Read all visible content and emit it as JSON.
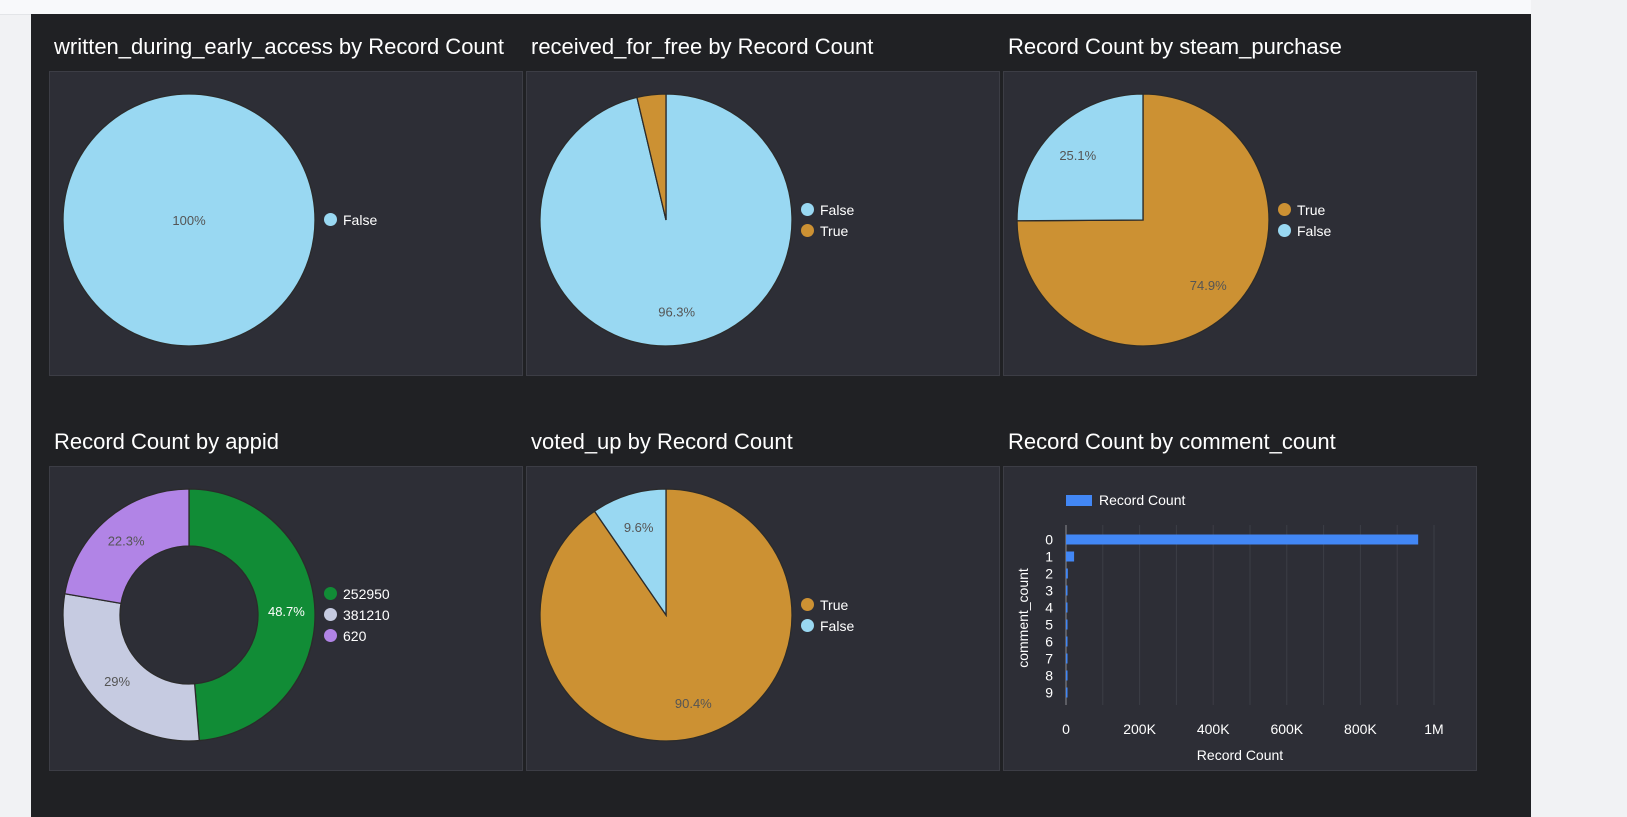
{
  "colors": {
    "gold": "#cc9133",
    "sky": "#99d8f2",
    "green": "#118c36",
    "lavender": "#c6cbe1",
    "purple": "#b184e6",
    "blue": "#4287f5",
    "panel_bg": "#2d2e36",
    "page_bg": "#202124"
  },
  "chart_data": [
    {
      "type": "pie",
      "title": "written_during_early_access by Record Count",
      "slices": [
        {
          "label": "False",
          "value": 100,
          "display": "100%",
          "color": "#99d8f2"
        }
      ],
      "legend": [
        "False"
      ]
    },
    {
      "type": "pie",
      "title": "received_for_free by Record Count",
      "slices": [
        {
          "label": "False",
          "value": 96.3,
          "display": "96.3%",
          "color": "#99d8f2"
        },
        {
          "label": "True",
          "value": 3.7,
          "display": "",
          "color": "#cc9133"
        }
      ],
      "legend": [
        "False",
        "True"
      ]
    },
    {
      "type": "pie",
      "title": "Record Count by steam_purchase",
      "slices": [
        {
          "label": "True",
          "value": 74.9,
          "display": "74.9%",
          "color": "#cc9133"
        },
        {
          "label": "False",
          "value": 25.1,
          "display": "25.1%",
          "color": "#99d8f2"
        }
      ],
      "legend": [
        "True",
        "False"
      ]
    },
    {
      "type": "pie",
      "donut": true,
      "title": "Record Count by appid",
      "slices": [
        {
          "label": "252950",
          "value": 48.7,
          "display": "48.7%",
          "color": "#118c36"
        },
        {
          "label": "381210",
          "value": 29.0,
          "display": "29%",
          "color": "#c6cbe1"
        },
        {
          "label": "620",
          "value": 22.3,
          "display": "22.3%",
          "color": "#b184e6"
        }
      ],
      "legend": [
        "252950",
        "381210",
        "620"
      ]
    },
    {
      "type": "pie",
      "title": "voted_up by Record Count",
      "slices": [
        {
          "label": "True",
          "value": 90.4,
          "display": "90.4%",
          "color": "#cc9133"
        },
        {
          "label": "False",
          "value": 9.6,
          "display": "9.6%",
          "color": "#99d8f2"
        }
      ],
      "legend": [
        "True",
        "False"
      ]
    },
    {
      "type": "bar",
      "orientation": "horizontal",
      "title": "Record Count by comment_count",
      "categories": [
        "0",
        "1",
        "2",
        "3",
        "4",
        "5",
        "6",
        "7",
        "8",
        "9"
      ],
      "series": [
        {
          "name": "Record Count",
          "values": [
            957000,
            22000,
            5000,
            2000,
            1000,
            700,
            500,
            400,
            300,
            200
          ],
          "color": "#4287f5"
        }
      ],
      "xlabel": "Record Count",
      "ylabel": "comment_count",
      "xlim": [
        0,
        1000000
      ],
      "xticks": [
        "0",
        "200K",
        "400K",
        "600K",
        "800K",
        "1M"
      ],
      "grid": true,
      "legend_position": "top-left"
    }
  ]
}
